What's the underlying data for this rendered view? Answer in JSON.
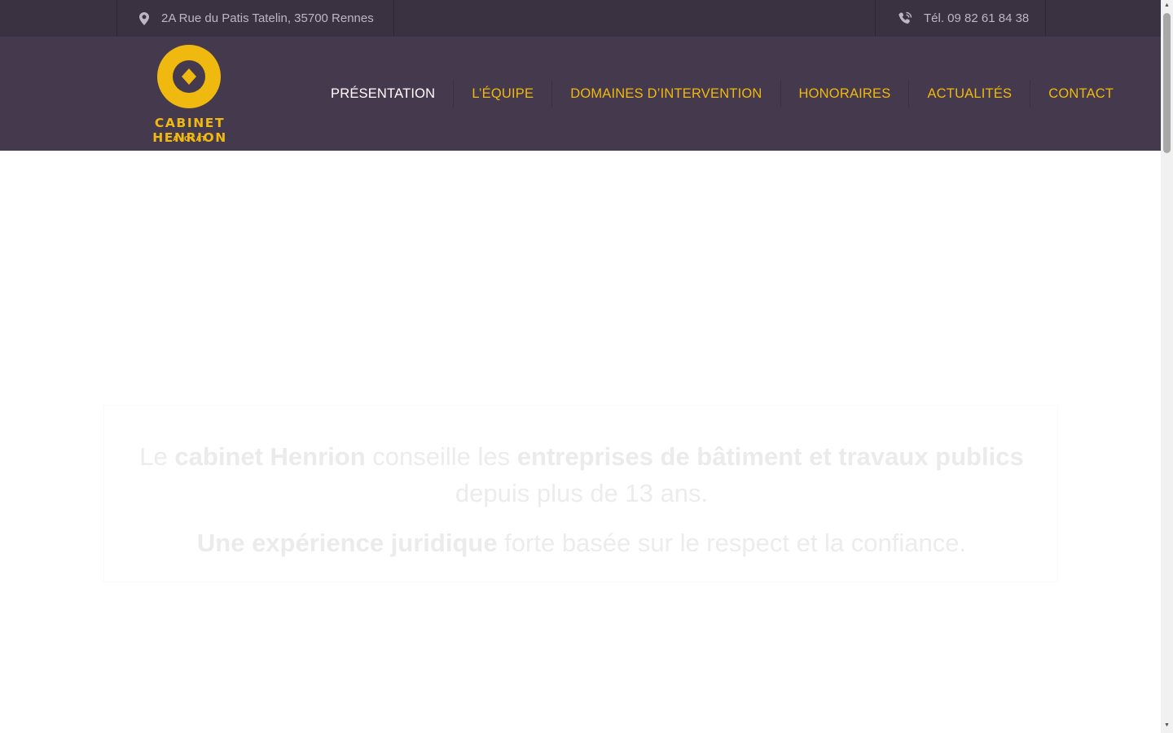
{
  "topbar": {
    "address": "2A Rue du Patis Tatelin, 35700 Rennes",
    "address_icon": "map-pin-icon",
    "phone": "Tél. 09 82 61 84 38",
    "phone_icon": "phone-icon"
  },
  "logo": {
    "name": "CABINET HENRION",
    "subtitle": "AVOCAT",
    "brand_color": "#f0b90f"
  },
  "nav": {
    "items": [
      {
        "label": "PRÉSENTATION",
        "active": true
      },
      {
        "label": "L’ÉQUIPE"
      },
      {
        "label": "DOMAINES D’INTERVENTION"
      },
      {
        "label": "HONORAIRES"
      },
      {
        "label": "ACTUALITÉS"
      },
      {
        "label": "CONTACT"
      }
    ]
  },
  "intro": {
    "p1_t1": "Le ",
    "p1_b1": "cabinet Henrion",
    "p1_t2": " conseille les ",
    "p1_b2": "entreprises de bâtiment et travaux publics",
    "p1_t3": " depuis plus de 13 ans.",
    "p2_b1": "Une expérience juridique",
    "p2_t1": " forte basée sur le respect et la confiance."
  },
  "colors": {
    "topbar_bg": "#3a3240",
    "header_bg": "#45394d",
    "accent": "#f0b90f",
    "nav_active": "#ffffff"
  }
}
